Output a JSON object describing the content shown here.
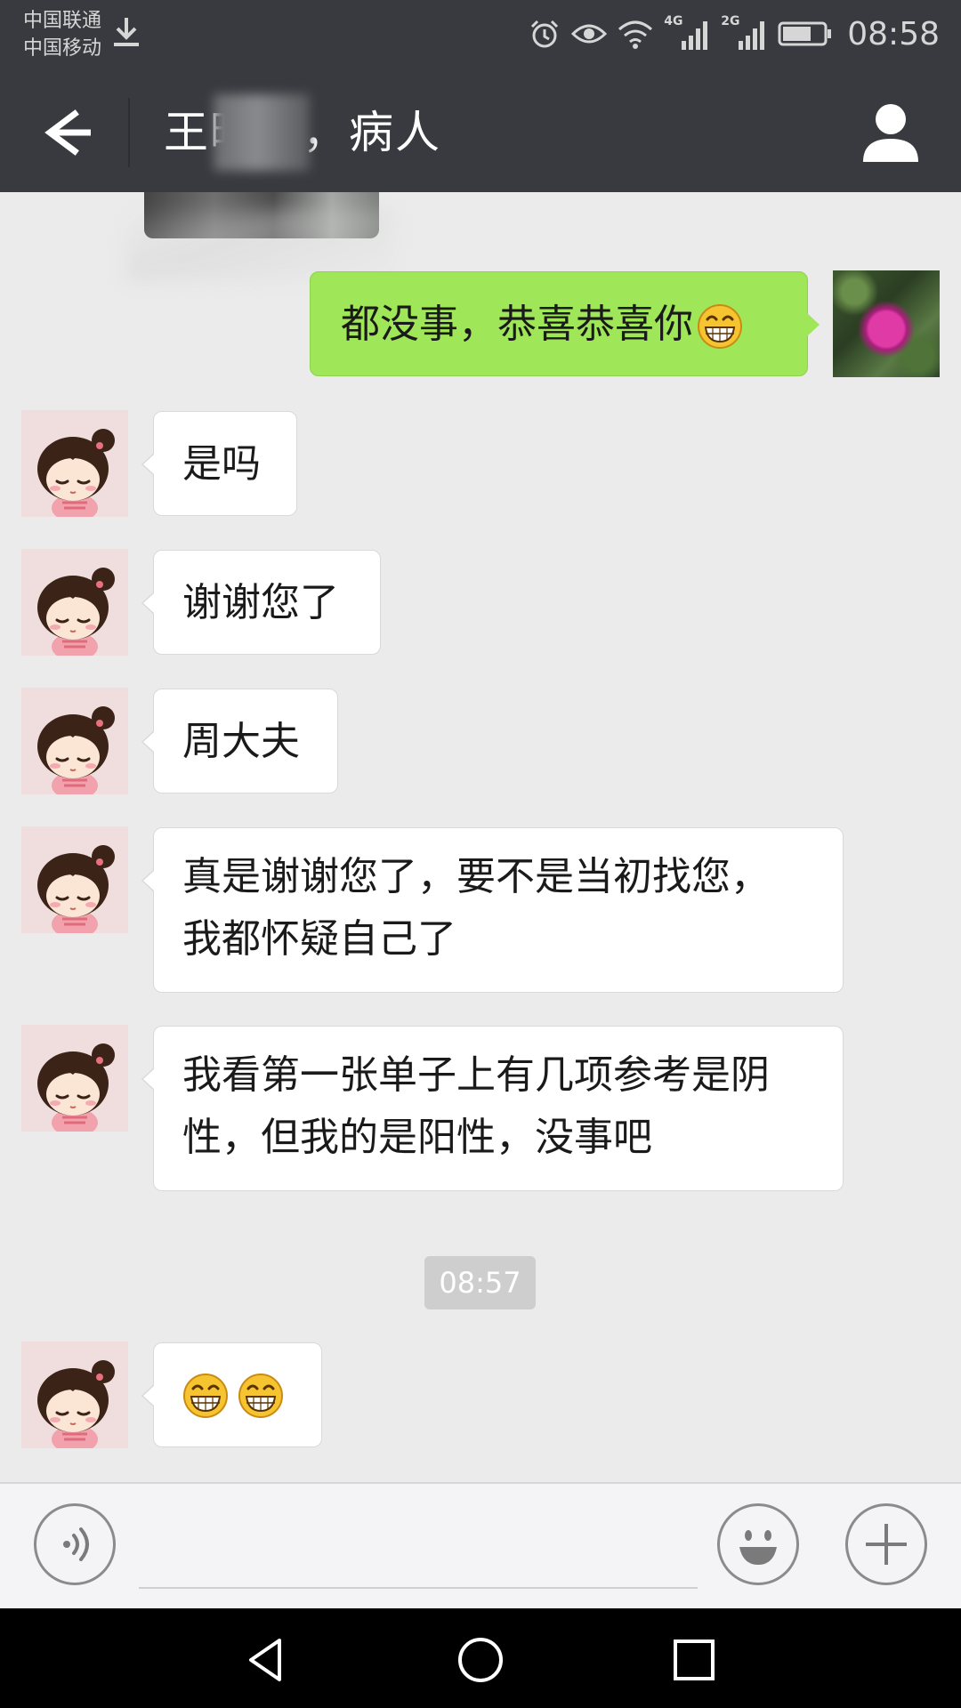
{
  "status_bar": {
    "carrier_1": "中国联通",
    "carrier_2": "中国移动",
    "network_1": "4G",
    "network_2": "2G",
    "time": "08:58",
    "battery_percent": 70,
    "icons": [
      "download-icon",
      "alarm-icon",
      "eye-icon",
      "wifi-icon",
      "signal-icon",
      "battery-icon"
    ]
  },
  "title_bar": {
    "title": "王晓明，病人"
  },
  "messages": [
    {
      "from": "me",
      "text": "都没事，恭喜恭喜你",
      "emoji": "grin"
    },
    {
      "from": "them",
      "text": "是吗"
    },
    {
      "from": "them",
      "text": "谢谢您了"
    },
    {
      "from": "them",
      "text": "周大夫"
    },
    {
      "from": "them",
      "lines": [
        "真是谢谢您了，要不是当初找您，",
        "我都怀疑自己了"
      ]
    },
    {
      "from": "them",
      "lines": [
        "我看第一张单子上有几项参考是阴",
        "性，但我的是阳性，没事吧"
      ]
    },
    {
      "from": "them",
      "emoji_count": 2
    }
  ],
  "timestamp": "08:57",
  "input_bar": {
    "placeholder": "",
    "icons": [
      "voice-icon",
      "emoji-icon",
      "plus-icon"
    ]
  },
  "nav_bar": {
    "icons": [
      "back-triangle-icon",
      "home-circle-icon",
      "recents-square-icon"
    ]
  },
  "colors": {
    "header_bg": "#393a3f",
    "chat_bg": "#ebebeb",
    "outgoing_bubble": "#9fe658",
    "incoming_bubble": "#ffffff"
  }
}
